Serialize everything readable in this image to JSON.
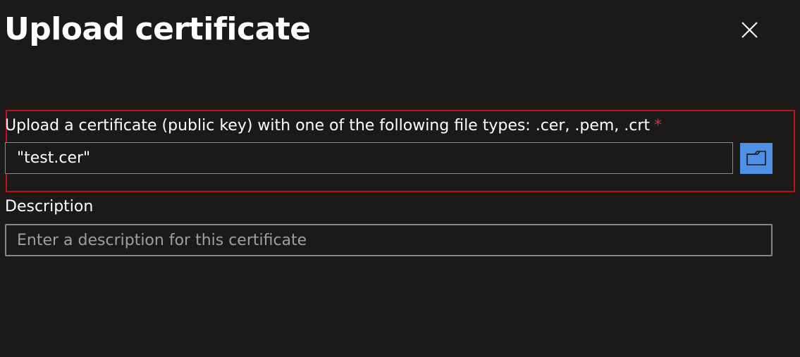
{
  "dialog": {
    "title": "Upload certificate",
    "close_label": "Close"
  },
  "upload": {
    "label": "Upload a certificate (public key) with one of the following file types: .cer, .pem, .crt",
    "required_marker": "*",
    "file_value": "\"test.cer\"",
    "browse_icon": "folder-icon",
    "browse_color": "#4f90e6"
  },
  "description": {
    "label": "Description",
    "placeholder": "Enter a description for this certificate",
    "value": ""
  },
  "colors": {
    "background": "#1b1a19",
    "highlight_border": "#c50f1f",
    "required": "#d13438"
  }
}
